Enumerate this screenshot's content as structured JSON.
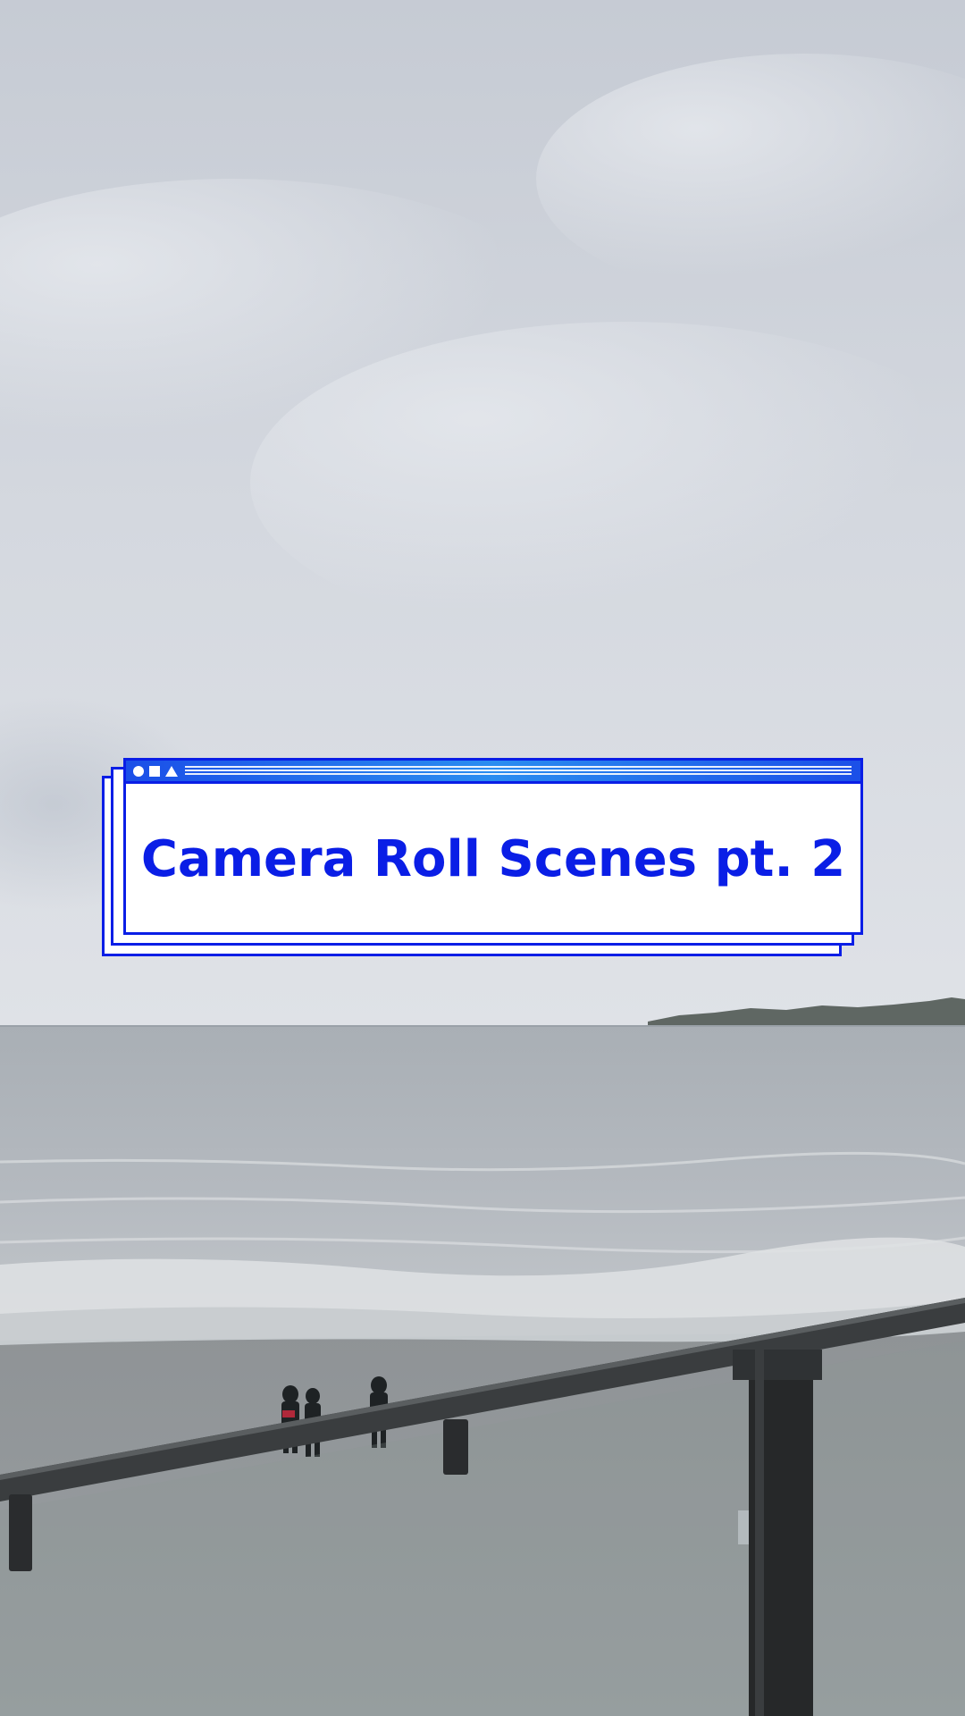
{
  "overlay": {
    "title": "Camera Roll Scenes pt. 2",
    "accent_color": "#0a1ee6",
    "titlebar_icons": [
      "circle-icon",
      "square-icon",
      "triangle-icon"
    ]
  },
  "scene": {
    "subject": "overcast seaside beach viewed from a railed balcony"
  }
}
